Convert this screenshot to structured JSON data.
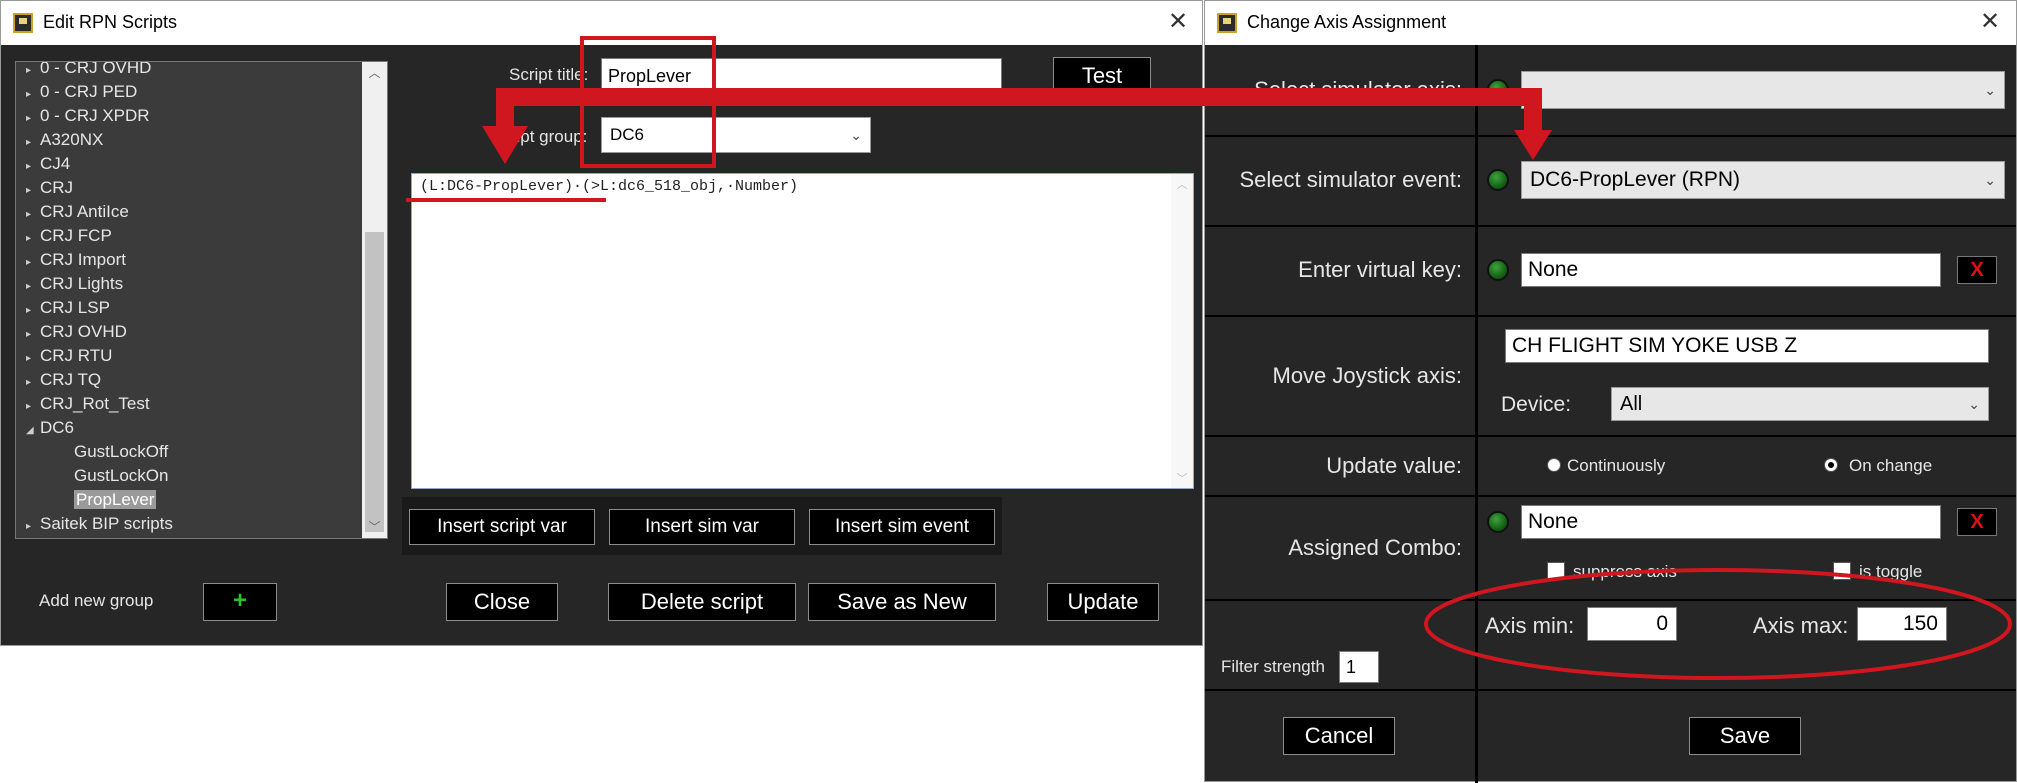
{
  "rpn_window": {
    "title": "Edit RPN Scripts",
    "close_glyph": "✕",
    "tree": [
      {
        "label": "0 - CRJ OVHD",
        "expander": "▸"
      },
      {
        "label": "0 - CRJ PED",
        "expander": "▸"
      },
      {
        "label": "0 - CRJ XPDR",
        "expander": "▸"
      },
      {
        "label": "A320NX",
        "expander": "▸"
      },
      {
        "label": "CJ4",
        "expander": "▸"
      },
      {
        "label": "CRJ",
        "expander": "▸"
      },
      {
        "label": "CRJ AntiIce",
        "expander": "▸"
      },
      {
        "label": "CRJ FCP",
        "expander": "▸"
      },
      {
        "label": "CRJ Import",
        "expander": "▸"
      },
      {
        "label": "CRJ Lights",
        "expander": "▸"
      },
      {
        "label": "CRJ LSP",
        "expander": "▸"
      },
      {
        "label": "CRJ OVHD",
        "expander": "▸"
      },
      {
        "label": "CRJ RTU",
        "expander": "▸"
      },
      {
        "label": "CRJ TQ",
        "expander": "▸"
      },
      {
        "label": "CRJ_Rot_Test",
        "expander": "▸"
      },
      {
        "label": "DC6",
        "expander": "◢"
      },
      {
        "label": "GustLockOff",
        "expander": ""
      },
      {
        "label": "GustLockOn",
        "expander": ""
      },
      {
        "label": "PropLever",
        "expander": "",
        "selected": true
      },
      {
        "label": "Saitek BIP scripts",
        "expander": "▸"
      }
    ],
    "script_title_label": "Script title:",
    "script_title_value": "PropLever",
    "script_group_label": "Script group:",
    "script_group_value": "DC6",
    "test_button": "Test",
    "script_text": "(L:DC6-PropLever)·(>L:dc6_518_obj,·Number)",
    "insert_script_var": "Insert script var",
    "insert_sim_var": "Insert sim var",
    "insert_sim_event": "Insert sim event",
    "add_new_group_label": "Add new group",
    "add_group_button": "+",
    "close_button": "Close",
    "delete_button": "Delete script",
    "save_as_new_button": "Save as New",
    "update_button": "Update"
  },
  "axis_window": {
    "title": "Change Axis Assignment",
    "close_glyph": "✕",
    "select_axis_label": "Select simulator axis:",
    "select_axis_value": "",
    "select_event_label": "Select simulator event:",
    "select_event_value": "DC6-PropLever (RPN)",
    "virtual_key_label": "Enter virtual key:",
    "virtual_key_value": "None",
    "clear_glyph": "X",
    "joystick_label": "Move Joystick axis:",
    "joystick_value": "CH FLIGHT SIM YOKE USB  Z",
    "device_label": "Device:",
    "device_value": "All",
    "update_label": "Update value:",
    "continuously_label": "Continuously",
    "on_change_label": "On change",
    "combo_label": "Assigned Combo:",
    "combo_value": "None",
    "suppress_axis_label": "suppress axis",
    "is_toggle_label": "is toggle",
    "axis_min_label": "Axis min:",
    "axis_min_value": "0",
    "axis_max_label": "Axis max:",
    "axis_max_value": "150",
    "filter_label": "Filter strength",
    "filter_value": "1",
    "cancel_button": "Cancel",
    "save_button": "Save"
  },
  "colors": {
    "annotation_red": "#d0161e",
    "panel_dark": "#262626",
    "led_green": "#2e8b2e"
  }
}
